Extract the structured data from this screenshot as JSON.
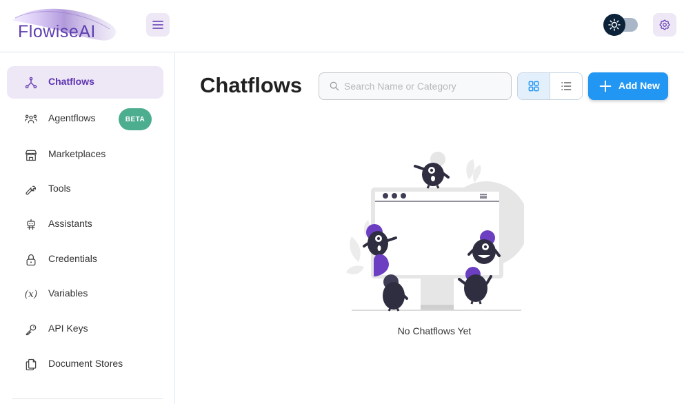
{
  "header": {
    "logo_text": "FlowiseAI",
    "menu_icon": "hamburger-icon",
    "theme_icon": "sun-icon",
    "settings_icon": "gear-icon"
  },
  "sidebar": {
    "items": [
      {
        "label": "Chatflows",
        "icon": "chatflow-icon",
        "active": true
      },
      {
        "label": "Agentflows",
        "icon": "agents-icon",
        "badge": "BETA"
      },
      {
        "label": "Marketplaces",
        "icon": "store-icon"
      },
      {
        "label": "Tools",
        "icon": "wrench-icon"
      },
      {
        "label": "Assistants",
        "icon": "robot-icon"
      },
      {
        "label": "Credentials",
        "icon": "lock-icon"
      },
      {
        "label": "Variables",
        "icon": "variable-icon"
      },
      {
        "label": "API Keys",
        "icon": "key-icon"
      },
      {
        "label": "Document Stores",
        "icon": "files-icon"
      }
    ]
  },
  "main": {
    "title": "Chatflows",
    "search": {
      "placeholder": "Search Name or Category",
      "value": ""
    },
    "view_modes": [
      "card-view",
      "list-view"
    ],
    "add_button_label": "Add New",
    "empty_message": "No Chatflows Yet"
  },
  "colors": {
    "primary": "#2196f3",
    "accent_purple": "#5e35b1",
    "active_bg": "#ede7f6",
    "beta_badge": "#4cae8f"
  }
}
